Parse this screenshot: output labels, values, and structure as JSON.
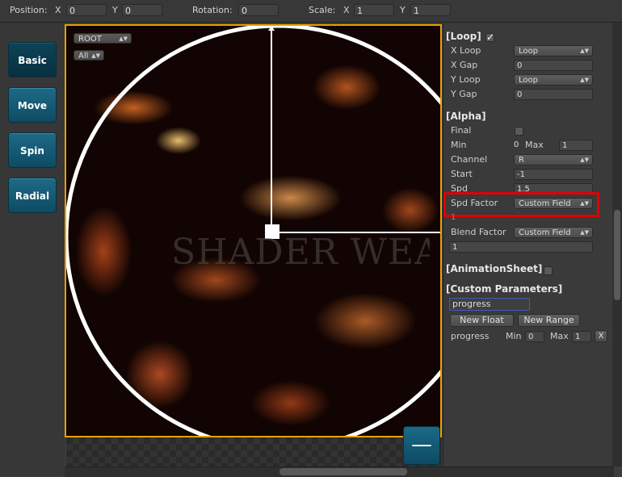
{
  "toolbar": {
    "position_label": "Position:",
    "x_label": "X",
    "x_value": "0",
    "y_label": "Y",
    "y_value": "0",
    "rotation_label": "Rotation:",
    "rotation_value": "0",
    "scale_label": "Scale:",
    "scale_x_label": "X",
    "scale_x_value": "1",
    "scale_y_label": "Y",
    "scale_y_value": "1"
  },
  "nav": {
    "items": [
      {
        "label": "Basic"
      },
      {
        "label": "Move"
      },
      {
        "label": "Spin"
      },
      {
        "label": "Radial"
      }
    ]
  },
  "canvas": {
    "layer_dropdown": "ROOT",
    "filter_dropdown": "All",
    "watermark": "SHADER WEAVER",
    "minus_label": "—"
  },
  "panel": {
    "loop": {
      "header": "[Loop]",
      "checked": true,
      "x_loop_label": "X Loop",
      "x_loop_value": "Loop",
      "x_gap_label": "X Gap",
      "x_gap_value": "0",
      "y_loop_label": "Y Loop",
      "y_loop_value": "Loop",
      "y_gap_label": "Y Gap",
      "y_gap_value": "0"
    },
    "alpha": {
      "header": "[Alpha]",
      "final_label": "Final",
      "min_label": "Min",
      "min_value": "0",
      "max_label": "Max",
      "max_value": "1",
      "channel_label": "Channel",
      "channel_value": "R",
      "start_label": "Start",
      "start_value": "-1",
      "spd_label": "Spd",
      "spd_value": "1.5",
      "spd_factor_label": "Spd Factor",
      "spd_factor_value": "Custom Field",
      "spd_factor_field": "1",
      "blend_factor_label": "Blend Factor",
      "blend_factor_value": "Custom Field",
      "blend_factor_field": "1"
    },
    "animation_sheet": {
      "header": "[AnimationSheet]"
    },
    "custom": {
      "header": "[Custom Parameters]",
      "name_input": "progress",
      "new_float": "New Float",
      "new_range": "New Range",
      "param_name": "progress",
      "param_min_label": "Min",
      "param_min_value": "0",
      "param_max_label": "Max",
      "param_max_value": "1",
      "remove_label": "X"
    }
  },
  "colors": {
    "accent_teal": "#0f4b63",
    "canvas_border": "#e8a100",
    "highlight_red": "#e00000"
  }
}
